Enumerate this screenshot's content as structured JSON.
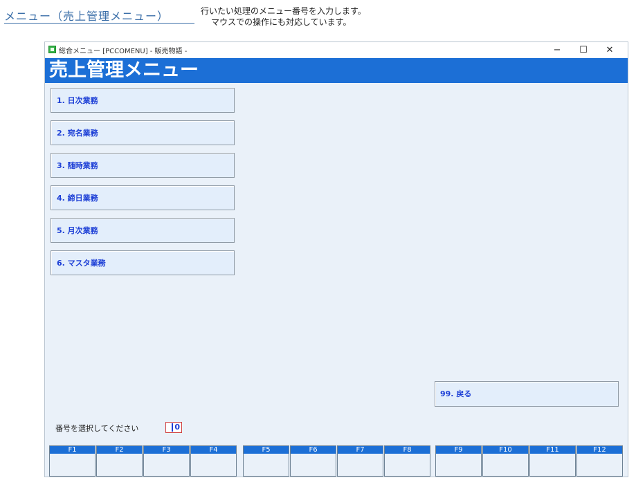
{
  "doc": {
    "title": "メニュー（売上管理メニュー）",
    "description_line1": "行いたい処理のメニュー番号を入力します。",
    "description_line2": "マウスでの操作にも対応しています。"
  },
  "window": {
    "title": "総合メニュー [PCCOMENU] - 販売物語 -",
    "minimize_glyph": "−",
    "maximize_glyph": "☐",
    "close_glyph": "✕"
  },
  "banner": {
    "title": "売上管理メニュー"
  },
  "menu": {
    "items": [
      {
        "label": "1. 日次業務"
      },
      {
        "label": "2. 宛名業務"
      },
      {
        "label": "3. 随時業務"
      },
      {
        "label": "4. 締日業務"
      },
      {
        "label": "5. 月次業務"
      },
      {
        "label": "6. マスタ業務"
      }
    ],
    "back_label": "99. 戻る"
  },
  "prompt": {
    "label": "番号を選択してください",
    "value": "0"
  },
  "fkeys": [
    "F1",
    "F2",
    "F3",
    "F4",
    "F5",
    "F6",
    "F7",
    "F8",
    "F9",
    "F10",
    "F11",
    "F12"
  ],
  "colors": {
    "accent": "#1c6fd6",
    "menu_text": "#1d3fd6",
    "panel_bg": "#eaf1f9",
    "button_bg": "#e3eefb"
  }
}
